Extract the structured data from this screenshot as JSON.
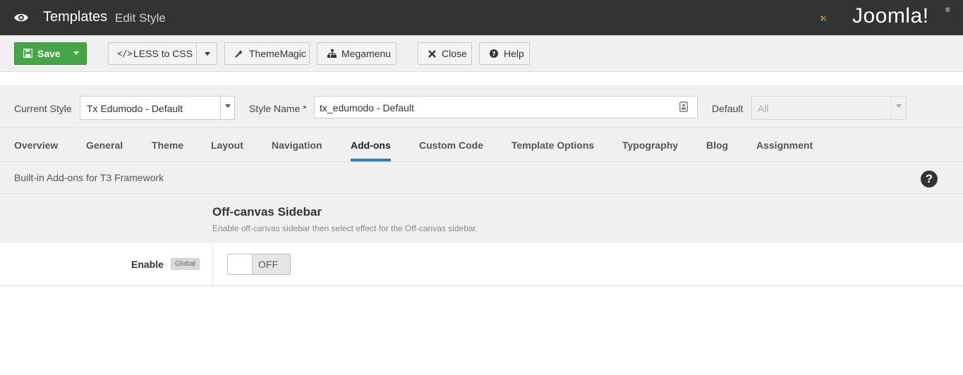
{
  "header": {
    "title": "Templates",
    "subtitle": "Edit Style",
    "logo_text": "Joomla!",
    "logo_reg": "®",
    "icon": "eye-icon"
  },
  "toolbar": {
    "save_label": "Save",
    "less_label": "LESS to CSS",
    "thememagic_label": "ThemeMagic",
    "megamenu_label": "Megamenu",
    "close_label": "Close",
    "help_label": "Help",
    "save_color": "#46a546"
  },
  "style": {
    "current_label": "Current Style",
    "current_value": "Tx Edumodo - Default",
    "name_label": "Style Name *",
    "name_value": "tx_edumodo - Default",
    "default_label": "Default",
    "default_value": "All"
  },
  "tabs": [
    {
      "label": "Overview"
    },
    {
      "label": "General"
    },
    {
      "label": "Theme"
    },
    {
      "label": "Layout"
    },
    {
      "label": "Navigation"
    },
    {
      "label": "Add-ons",
      "active": true
    },
    {
      "label": "Custom Code"
    },
    {
      "label": "Template Options"
    },
    {
      "label": "Typography"
    },
    {
      "label": "Blog"
    },
    {
      "label": "Assignment"
    }
  ],
  "section": {
    "description": "Built-in Add-ons for T3 Framework",
    "help_glyph": "?"
  },
  "offcanvas": {
    "title": "Off-canvas Sidebar",
    "description": "Enable off-canvas sidebar then select effect for the Off-canvas sidebar.",
    "enable_label": "Enable",
    "badge": "Global",
    "toggle_state": "OFF"
  },
  "accent_color": "#2f7fc0"
}
